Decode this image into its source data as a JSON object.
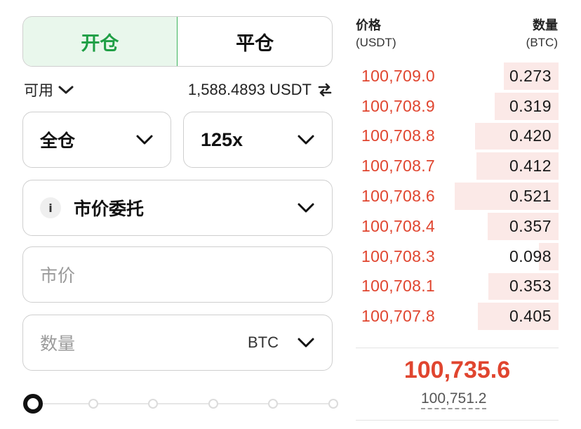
{
  "tabs": {
    "open_label": "开仓",
    "close_label": "平仓",
    "active": "open"
  },
  "available": {
    "label": "可用",
    "amount": "1,588.4893 USDT"
  },
  "margin_mode": {
    "value": "全仓"
  },
  "leverage": {
    "value": "125x"
  },
  "order_type": {
    "info_glyph": "i",
    "value": "市价委托"
  },
  "price_input": {
    "placeholder": "市价"
  },
  "quantity_input": {
    "placeholder": "数量",
    "unit": "BTC"
  },
  "slider": {
    "value_percent": 0,
    "stops_percent": [
      0,
      20,
      40,
      60,
      80,
      100
    ]
  },
  "order_book": {
    "price_header": "价格",
    "price_unit": "(USDT)",
    "qty_header": "数量",
    "qty_unit": "(BTC)",
    "max_depth_qty": 0.521,
    "asks": [
      {
        "price": "100,709.0",
        "qty": "0.273"
      },
      {
        "price": "100,708.9",
        "qty": "0.319"
      },
      {
        "price": "100,708.8",
        "qty": "0.420"
      },
      {
        "price": "100,708.7",
        "qty": "0.412"
      },
      {
        "price": "100,708.6",
        "qty": "0.521"
      },
      {
        "price": "100,708.4",
        "qty": "0.357"
      },
      {
        "price": "100,708.3",
        "qty": "0.098"
      },
      {
        "price": "100,708.1",
        "qty": "0.353"
      },
      {
        "price": "100,707.8",
        "qty": "0.405"
      }
    ],
    "last_price": "100,735.6",
    "mark_price": "100,751.2"
  },
  "colors": {
    "accent_green": "#1f9f45",
    "ask_red": "#e0452f",
    "depth_red": "#fbe9e7"
  },
  "icons": {
    "dropdown": "chevron-down-icon",
    "swap": "swap-arrows-icon",
    "info": "info-icon"
  }
}
